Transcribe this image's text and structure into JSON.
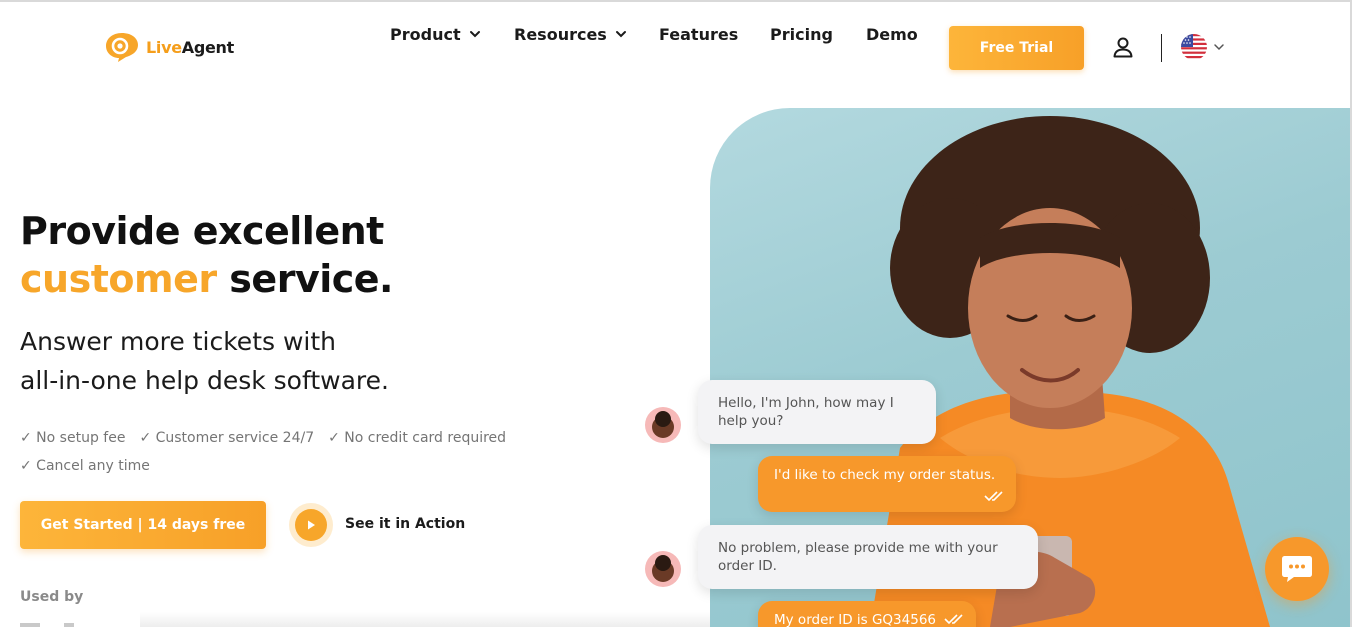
{
  "brand": {
    "name_part1": "Live",
    "name_part2": "Agent",
    "accent_color": "#f7a62a"
  },
  "nav": {
    "items": [
      {
        "label": "Product",
        "has_dropdown": true
      },
      {
        "label": "Resources",
        "has_dropdown": true
      },
      {
        "label": "Features",
        "has_dropdown": false
      },
      {
        "label": "Pricing",
        "has_dropdown": false
      },
      {
        "label": "Demo",
        "has_dropdown": false
      }
    ],
    "cta_label": "Free Trial",
    "user_icon": "user-icon",
    "language_icon": "us-flag-icon"
  },
  "hero": {
    "title_line1": "Provide excellent",
    "title_highlight": "customer",
    "title_rest": " service.",
    "subtitle_line1": "Answer more tickets with",
    "subtitle_line2": "all-in-one help desk software.",
    "checks": [
      "✓ No setup fee",
      "✓ Customer service 24/7",
      "✓ No credit card required",
      "✓ Cancel any time"
    ],
    "primary_cta": "Get Started | 14 days free",
    "secondary_cta": "See it in Action",
    "used_by": "Used by"
  },
  "chat": {
    "messages": [
      {
        "from": "agent",
        "text": "Hello, I'm John, how may I help you?"
      },
      {
        "from": "user",
        "text": "I'd like to check my order status."
      },
      {
        "from": "agent",
        "text": "No problem, please provide me with your order ID."
      },
      {
        "from": "user",
        "text": "My order ID is GQ34566"
      }
    ]
  }
}
